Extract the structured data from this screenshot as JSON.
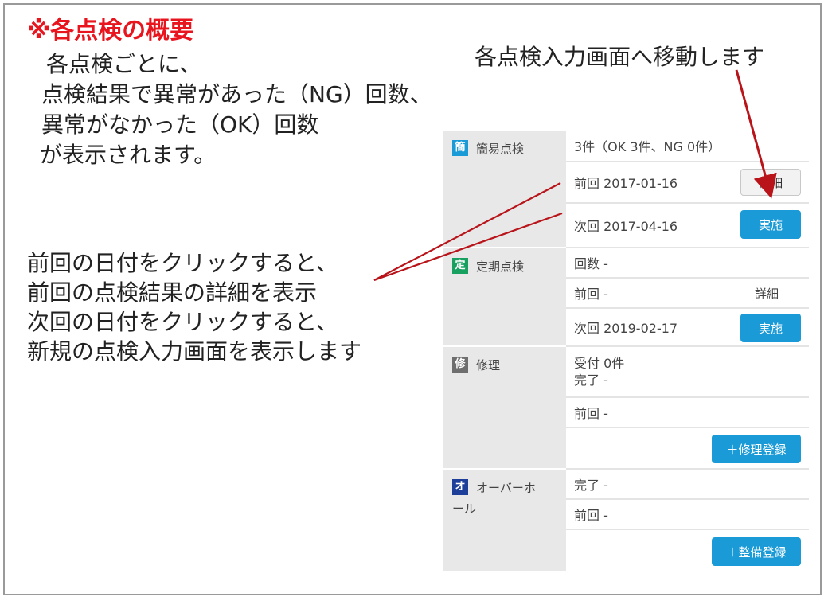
{
  "heading": "※各点検の概要",
  "description": [
    "各点検ごとに、",
    "点検結果で異常があった（NG）回数、",
    "異常がなかった（OK）回数",
    "が表示されます。"
  ],
  "callout_top": "各点検入力画面へ移動します",
  "callout_left": [
    "前回の日付をクリックすると、",
    "前回の点検結果の詳細を表示",
    "次回の日付をクリックすると、",
    "新規の点検入力画面を表示します"
  ],
  "colors": {
    "accent_red": "#e8141e",
    "button_blue": "#1a9ad6",
    "badge_blue": "#1a9ad6",
    "badge_green": "#17a060",
    "badge_gray": "#6e6e6e",
    "badge_navy": "#1d3f9a",
    "arrow": "#b8141a"
  },
  "sections": {
    "simple": {
      "badge": "簡",
      "label": "簡易点検",
      "summary": "3件（OK 3件、NG 0件）",
      "prev": "前回 2017-01-16",
      "detail_btn": "詳細",
      "next": "次回 2017-04-16",
      "do_btn": "実施"
    },
    "periodic": {
      "badge": "定",
      "label": "定期点検",
      "count": "回数 -",
      "prev": "前回 -",
      "detail_link": "詳細",
      "next": "次回 2019-02-17",
      "do_btn": "実施"
    },
    "repair": {
      "badge": "修",
      "label": "修理",
      "received": "受付 0件",
      "done": "完了 -",
      "prev": "前回 -",
      "register_btn": "＋修理登録"
    },
    "overhaul": {
      "badge": "オ",
      "label_line1": "オーバーホ",
      "label_line2": "ール",
      "done": "完了 -",
      "prev": "前回 -",
      "register_btn": "＋整備登録"
    }
  }
}
